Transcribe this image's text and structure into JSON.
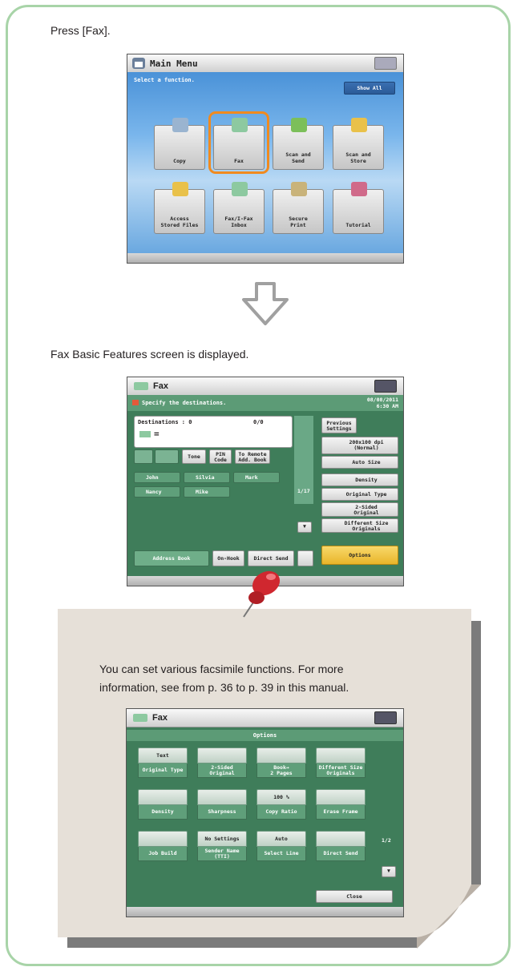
{
  "step1": {
    "instruction": "Press [Fax].",
    "screen": {
      "title": "Main Menu",
      "subtitle": "Select a function.",
      "show_all": "Show All",
      "buttons": [
        "Copy",
        "Fax",
        "Scan and\nSend",
        "Scan and\nStore",
        "Access\nStored Files",
        "Fax/I-Fax\nInbox",
        "Secure\nPrint",
        "Tutorial"
      ],
      "highlighted": "Fax"
    }
  },
  "step2": {
    "instruction": "Fax Basic Features screen is displayed.",
    "screen": {
      "title": "Fax",
      "message": "Specify the destinations.",
      "date": "08/08/2011",
      "time": "6:30 AM",
      "destinations_label": "Destinations : 0",
      "destinations_count": "0/0",
      "keys": [
        "Tone",
        "PIN\nCode",
        "To Remote\nAdd. Book"
      ],
      "names": [
        "John",
        "Silvia",
        "Mark",
        "Nancy",
        "Mike"
      ],
      "page": "1/17",
      "address_book": "Address Book",
      "on_hook": "On-Hook",
      "direct_send": "Direct Send",
      "previous_settings": "Previous\nSettings",
      "resolution": "200x100 dpi\n(Normal)",
      "auto_size": "Auto Size",
      "settings": [
        "Density",
        "Original Type",
        "2-Sided\nOriginal",
        "Different Size\nOriginals"
      ],
      "options": "Options"
    }
  },
  "note": {
    "text_line1": "You can set various facsimile functions. For more",
    "text_line2": "information, see from p. 36 to p. 39 in this manual.",
    "screen": {
      "title": "Fax",
      "header": "Options",
      "options": [
        {
          "top": "Text",
          "bottom": "Original Type"
        },
        {
          "top": "",
          "bottom": "2-Sided\nOriginal"
        },
        {
          "top": "",
          "bottom": "Book→\n2 Pages"
        },
        {
          "top": "",
          "bottom": "Different Size\nOriginals"
        },
        {
          "top": "",
          "bottom": "Density"
        },
        {
          "top": "",
          "bottom": "Sharpness"
        },
        {
          "top": "100 %",
          "bottom": "Copy Ratio"
        },
        {
          "top": "",
          "bottom": "Erase Frame"
        },
        {
          "top": "",
          "bottom": "Job Build"
        },
        {
          "top": "No Settings",
          "bottom": "Sender Name\n(TTI)"
        },
        {
          "top": "Auto",
          "bottom": "Select Line"
        },
        {
          "top": "",
          "bottom": "Direct Send"
        }
      ],
      "page": "1/2",
      "close": "Close"
    }
  }
}
